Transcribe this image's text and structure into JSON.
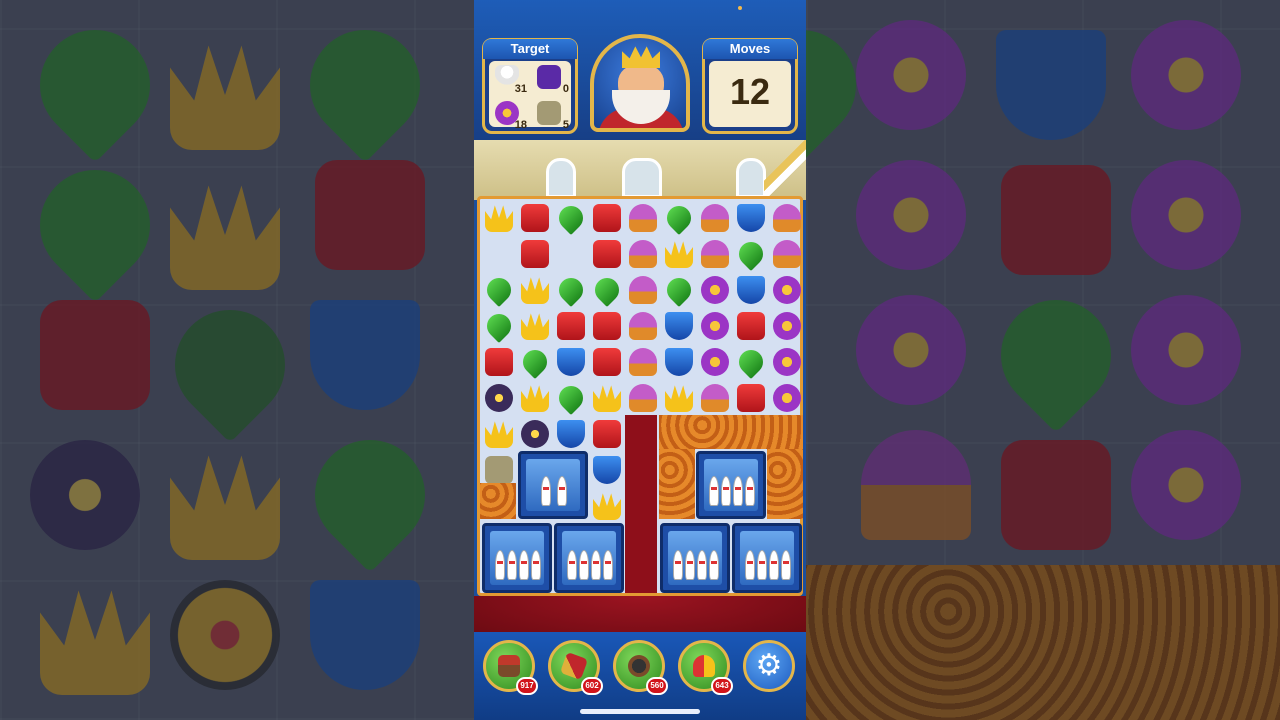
{
  "game": {
    "target_title": "Target",
    "moves_title": "Moves",
    "moves_left": "12",
    "targets": [
      {
        "icon": "bowling-pin-icon",
        "count": "31"
      },
      {
        "icon": "purple-tile-icon",
        "count": "0"
      },
      {
        "icon": "flower-pot-icon",
        "count": "18"
      },
      {
        "icon": "bone-tile-icon",
        "count": "5"
      }
    ],
    "boosters": [
      {
        "name": "hammer-booster",
        "count": "917"
      },
      {
        "name": "arrow-booster",
        "count": "602"
      },
      {
        "name": "cannon-booster",
        "count": "560"
      },
      {
        "name": "jester-hat-booster",
        "count": "643"
      }
    ],
    "settings_icon": "gear-icon"
  },
  "colors": {
    "panel_border": "#e3b64a",
    "topbar_blue": "#1e5db8",
    "board_bg": "#d5e0f2",
    "carpet": "#8e0f1a"
  }
}
